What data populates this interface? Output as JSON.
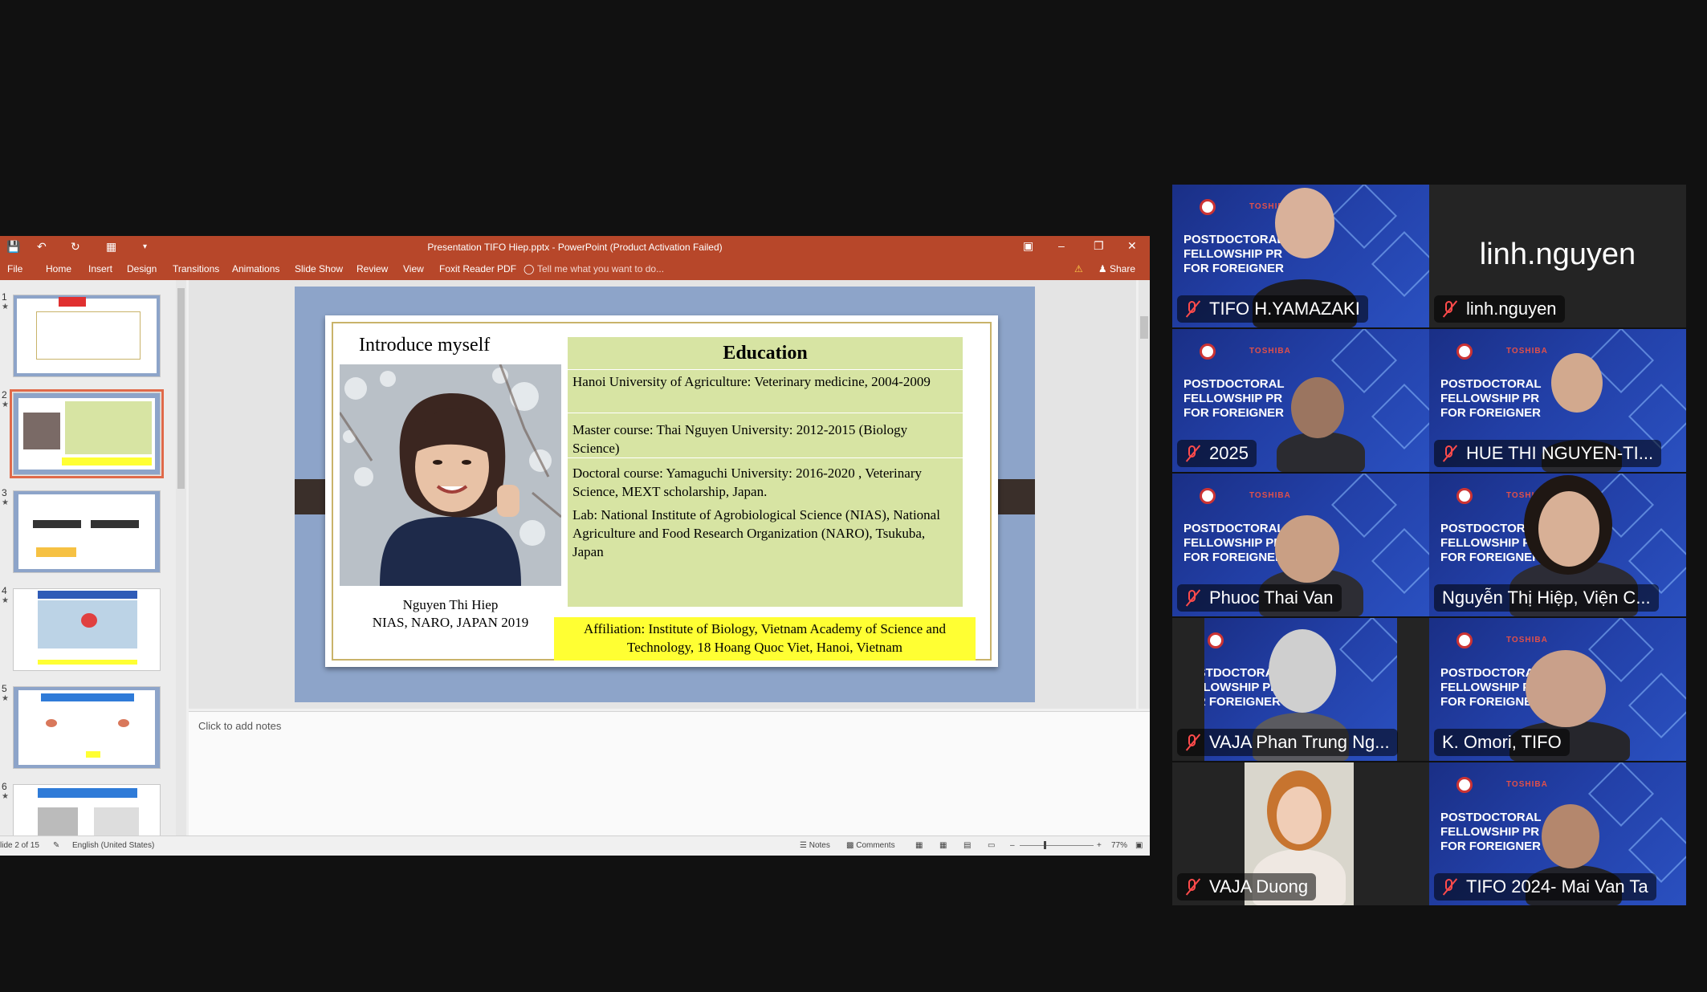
{
  "powerpoint": {
    "window_title": "Presentation TIFO Hiep.pptx - PowerPoint (Product Activation Failed)",
    "tabs": [
      "File",
      "Home",
      "Insert",
      "Design",
      "Transitions",
      "Animations",
      "Slide Show",
      "Review",
      "View",
      "Foxit Reader PDF"
    ],
    "tell_me_placeholder": "Tell me what you want to do...",
    "share_label": "Share",
    "thumbnail_numbers": [
      "1",
      "2",
      "3",
      "4",
      "5",
      "6"
    ],
    "selected_slide": 2,
    "slide": {
      "intro_title": "Introduce myself",
      "caption_name": "Nguyen Thi Hiep",
      "caption_org": "NIAS, NARO, JAPAN 2019",
      "education_title": "Education",
      "education_lines": [
        "Hanoi University of Agriculture: Veterinary medicine, 2004-2009",
        "Master course: Thai Nguyen University: 2012-2015 (Biology Science)",
        "Doctoral course: Yamaguchi University: 2016-2020 , Veterinary Science, MEXT scholarship, Japan.",
        "Lab: National Institute of Agrobiological Science (NIAS), National Agriculture and Food Research Organization (NARO), Tsukuba, Japan"
      ],
      "affiliation": "Affiliation: Institute of Biology, Vietnam Academy of Science and Technology, 18 Hoang Quoc Viet, Hanoi, Vietnam"
    },
    "notes_placeholder": "Click to add notes",
    "status": {
      "slide_counter": "lide 2 of 15",
      "language": "English (United States)",
      "notes_label": "Notes",
      "comments_label": "Comments",
      "zoom": "77%"
    }
  },
  "zoom_gallery": {
    "participants": [
      {
        "name": "TIFO H.YAMAZAKI",
        "muted": true,
        "video": true
      },
      {
        "name": "linh.nguyen",
        "muted": true,
        "video": false,
        "display_name_large": "linh.nguyen"
      },
      {
        "name": "2025",
        "muted": true,
        "video": true
      },
      {
        "name": "HUE THI NGUYEN-TI...",
        "muted": true,
        "video": true
      },
      {
        "name": "Phuoc Thai Van",
        "muted": true,
        "video": true
      },
      {
        "name": "Nguyễn Thị Hiệp, Viện C...",
        "muted": false,
        "video": true,
        "active_speaker": true
      },
      {
        "name": "VAJA Phan Trung Ng...",
        "muted": true,
        "video": true
      },
      {
        "name": "K. Omori, TIFO",
        "muted": false,
        "video": true
      },
      {
        "name": "VAJA Duong",
        "muted": true,
        "video": true
      },
      {
        "name": "TIFO 2024- Mai Van Ta",
        "muted": true,
        "video": true
      }
    ],
    "banner_text": {
      "toshiba": "TOSHIBA",
      "line1": "POSTDOCTORAL",
      "line2": "FELLOWSHIP PR",
      "line3": "FOR FOREIGNER"
    },
    "colors": {
      "active_border": "#6ad35a",
      "mute_red": "#ff4b4b",
      "banner_blue": "#223fa6"
    }
  }
}
